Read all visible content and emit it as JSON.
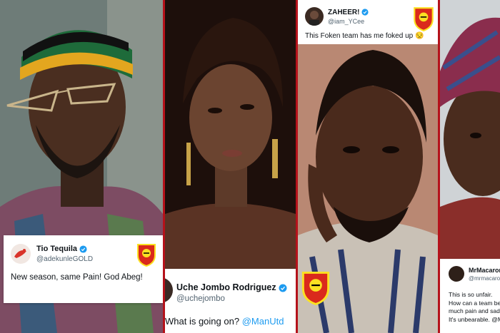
{
  "tweets": [
    {
      "name": "Tio Tequila",
      "handle": "@adekunleGOLD",
      "text": "New season, same Pain! God Abeg!"
    },
    {
      "name": "Uche Jombo Rodriguez",
      "handle": "@uchejombo",
      "text_before": "What is going on?",
      "mention": "@ManUtd"
    },
    {
      "name": "ZAHEER!",
      "handle": "@iam_YCee",
      "text": "This Foken team has me foked up",
      "emoji": "😒"
    },
    {
      "name": "MrMacaron",
      "handle": "@mrmacaro",
      "lines": [
        "This is so unfair.",
        "How can a team be",
        "much pain and sadr",
        "It's unbearable. @M"
      ]
    }
  ],
  "colors": {
    "divider": "#b5121b",
    "verified": "#1d9bf0",
    "crest_red": "#da291c",
    "crest_yellow": "#fbe122"
  },
  "icons": [
    "verified-badge-icon",
    "manchester-united-crest-icon"
  ]
}
